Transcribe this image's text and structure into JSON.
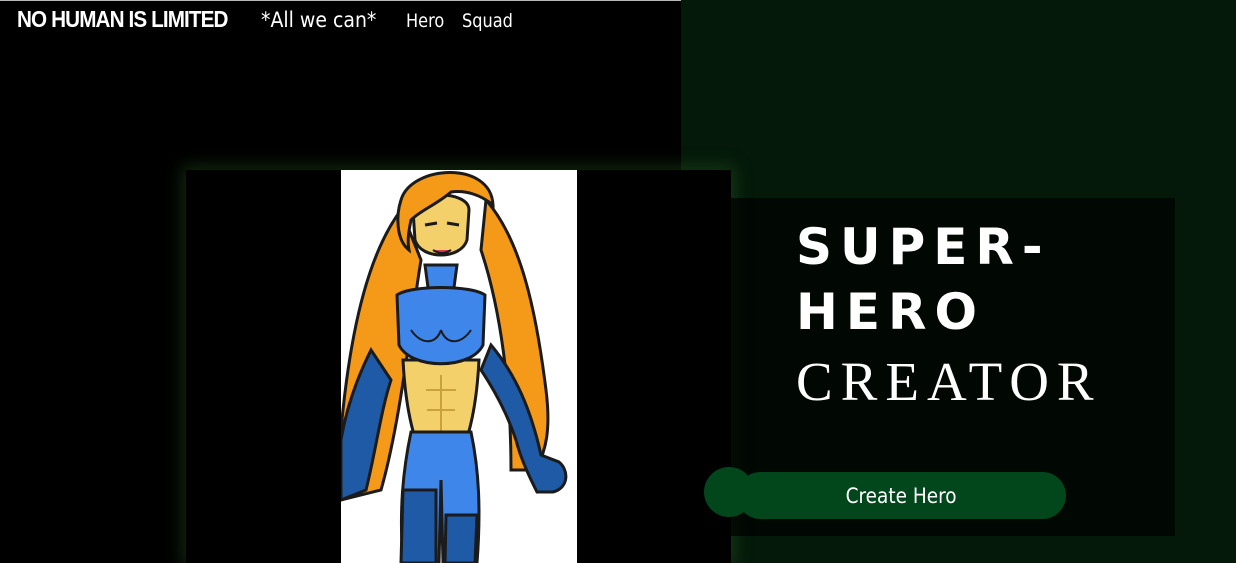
{
  "navbar": {
    "brand": "NO HUMAN IS LIMITED",
    "tagline": "*All we can*",
    "links": [
      {
        "label": "Hero"
      },
      {
        "label": "Squad"
      }
    ]
  },
  "hero_image": {
    "alt": "superhero-illustration"
  },
  "title": {
    "line1": "SUPER-",
    "line2": "HERO",
    "line3": "CREATOR"
  },
  "cta": {
    "label": "Create Hero"
  },
  "colors": {
    "background": "#000000",
    "right_panel": "#04190a",
    "button": "#02461c",
    "hair": "#f59a18",
    "suit_light": "#3f86ea",
    "suit_dark": "#1f5aa6",
    "skin": "#f4d06a"
  }
}
